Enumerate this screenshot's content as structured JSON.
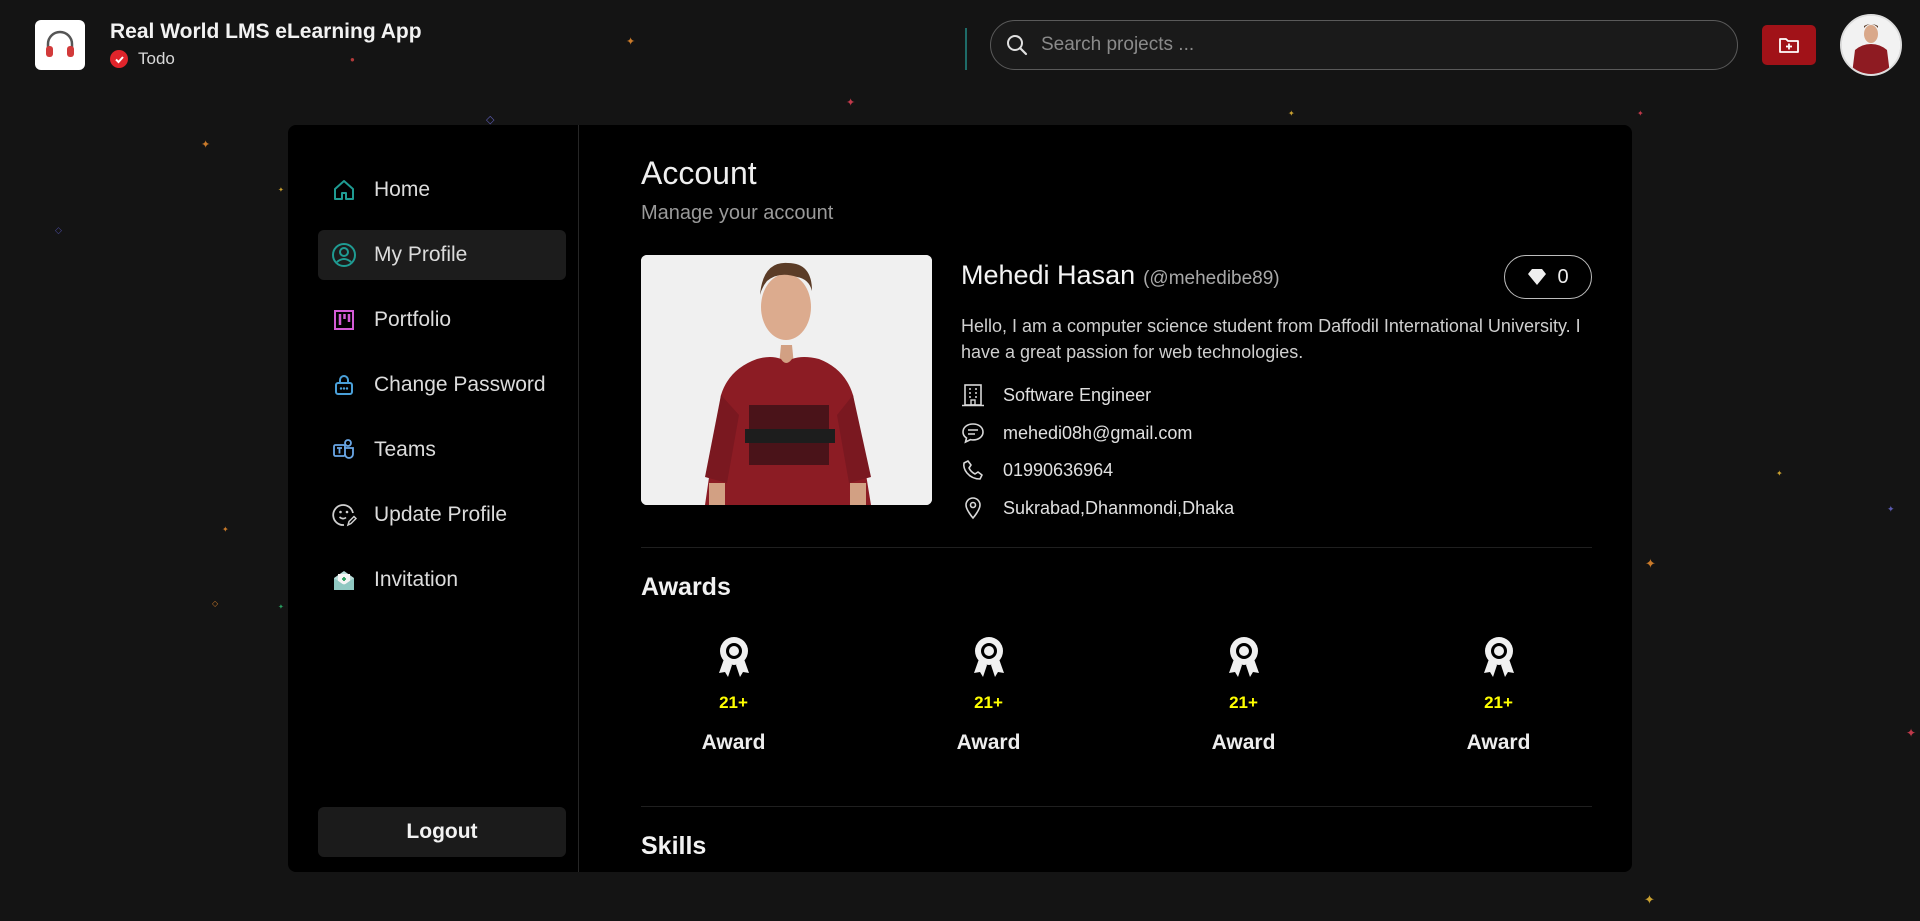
{
  "header": {
    "app_title": "Real World LMS eLearning App",
    "status_label": "Todo",
    "search_placeholder": "Search projects ..."
  },
  "sidebar": {
    "items": [
      {
        "label": "Home",
        "icon": "home-icon"
      },
      {
        "label": "My Profile",
        "icon": "user-circle-icon",
        "active": true
      },
      {
        "label": "Portfolio",
        "icon": "kanban-icon"
      },
      {
        "label": "Change Password",
        "icon": "lock-icon"
      },
      {
        "label": "Teams",
        "icon": "teams-icon"
      },
      {
        "label": "Update Profile",
        "icon": "smile-edit-icon"
      },
      {
        "label": "Invitation",
        "icon": "envelope-open-icon"
      }
    ],
    "logout_label": "Logout"
  },
  "account": {
    "title": "Account",
    "subtitle": "Manage your account"
  },
  "profile": {
    "name": "Mehedi Hasan",
    "handle": "(@mehedibe89)",
    "likes": "0",
    "bio": "Hello, I am a computer science student from Daffodil International University. I have a great passion for web technologies.",
    "occupation": "Software Engineer",
    "email": "mehedi08h@gmail.com",
    "phone": "01990636964",
    "address": "Sukrabad,Dhanmondi,Dhaka"
  },
  "awards": {
    "title": "Awards",
    "items": [
      {
        "count": "21+",
        "label": "Award"
      },
      {
        "count": "21+",
        "label": "Award"
      },
      {
        "count": "21+",
        "label": "Award"
      },
      {
        "count": "21+",
        "label": "Award"
      }
    ]
  },
  "skills": {
    "title": "Skills"
  },
  "colors": {
    "background": "#141414",
    "card": "#000000",
    "accent_teal": "#1f9b92",
    "accent_red": "#a11218",
    "award_count": "#ffff00",
    "portfolio_icon": "#d45bd6"
  }
}
